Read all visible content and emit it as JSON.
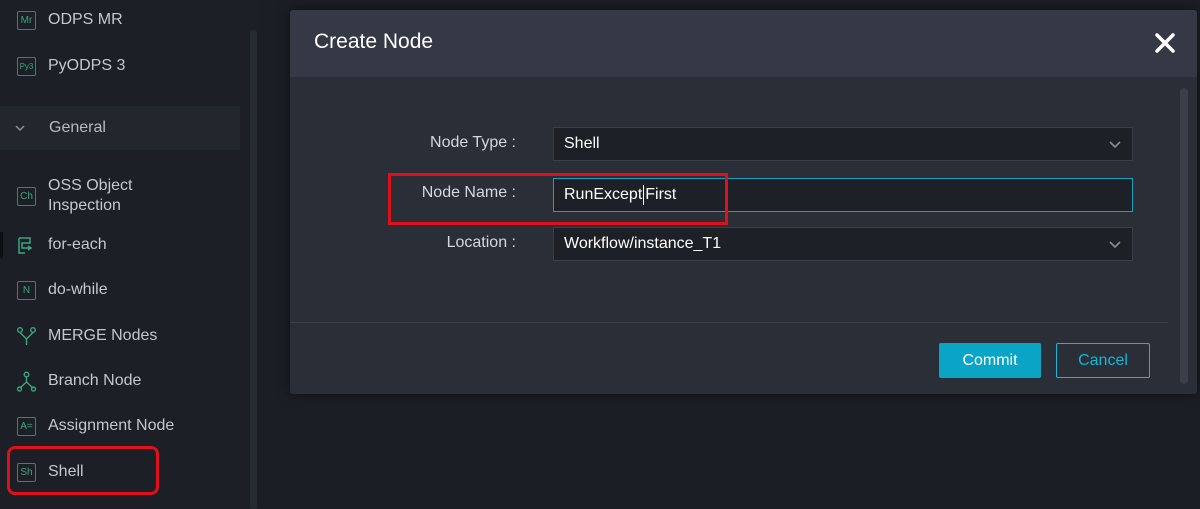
{
  "sidebar": {
    "items_top": [
      {
        "icon": "Mr",
        "label": "ODPS MR"
      },
      {
        "icon": "Py3",
        "label": "PyODPS 3"
      }
    ],
    "group_label": "General",
    "items": [
      {
        "icon": "Ch",
        "label": "OSS Object\nInspection"
      },
      {
        "icon": "for-each-icon",
        "label": "for-each"
      },
      {
        "icon": "N",
        "label": "do-while"
      },
      {
        "icon": "merge-icon",
        "label": "MERGE Nodes"
      },
      {
        "icon": "branch-icon",
        "label": "Branch Node"
      },
      {
        "icon": "A=",
        "label": "Assignment Node"
      },
      {
        "icon": "Sh",
        "label": "Shell"
      }
    ]
  },
  "modal": {
    "title": "Create Node",
    "fields": {
      "node_type": {
        "label": "Node Type :",
        "value": "Shell"
      },
      "node_name": {
        "label": "Node Name :",
        "value_before_caret": "RunExcept",
        "value_after_caret": "First"
      },
      "location": {
        "label": "Location :",
        "value": "Workflow/instance_T1"
      }
    },
    "commit_label": "Commit",
    "cancel_label": "Cancel"
  },
  "colors": {
    "accent": "#0aa5c6",
    "icon_green": "#3aa57f",
    "highlight_red": "#e0101a"
  }
}
